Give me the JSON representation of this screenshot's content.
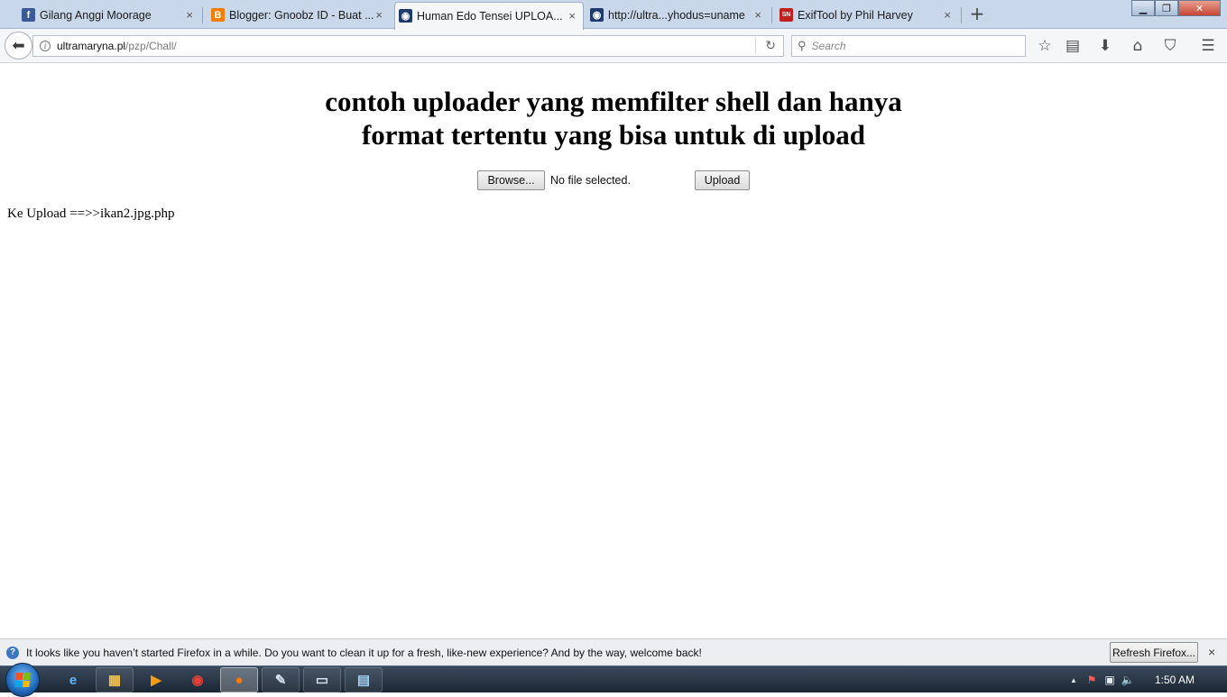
{
  "window": {
    "controls": {
      "minimize": "▁",
      "maximize": "❐",
      "close": "✕"
    }
  },
  "tabs": [
    {
      "label": "Gilang Anggi Moorage",
      "favicon": "facebook-icon",
      "favicon_text": "f",
      "favicon_color": "#3b5998",
      "active": false
    },
    {
      "label": "Blogger: Gnoobz ID - Buat ...",
      "favicon": "blogger-icon",
      "favicon_text": "B",
      "favicon_color": "#f57d00",
      "active": false
    },
    {
      "label": "Human Edo Tensei UPLOA...",
      "favicon": "site-globe-icon",
      "favicon_text": "◉",
      "favicon_color": "#1d3b6e",
      "active": true
    },
    {
      "label": "http://ultra...yhodus=uname",
      "favicon": "site-globe-icon",
      "favicon_text": "◉",
      "favicon_color": "#1d3b6e",
      "active": false
    },
    {
      "label": "ExifTool by Phil Harvey",
      "favicon": "exiftool-icon",
      "favicon_text": "SN",
      "favicon_color": "#c02020",
      "active": false
    }
  ],
  "tab_close_glyph": "×",
  "new_tab_glyph": "+",
  "navbar": {
    "back_glyph": "⬅",
    "info_glyph": "i",
    "url_domain": "ultramaryna.pl",
    "url_path": "/pzp/Chall/",
    "reload_glyph": "↻",
    "search_placeholder": "Search",
    "search_glyph": "⚲",
    "toolbar_icons": [
      {
        "name": "bookmark-star-icon",
        "glyph": "☆"
      },
      {
        "name": "reading-list-icon",
        "glyph": "▤"
      },
      {
        "name": "downloads-icon",
        "glyph": "⬇"
      },
      {
        "name": "home-icon",
        "glyph": "⌂"
      },
      {
        "name": "pocket-icon",
        "glyph": "⛉"
      },
      {
        "name": "menu-icon",
        "glyph": "☰"
      }
    ]
  },
  "page": {
    "title_line1": "contoh uploader yang memfilter shell dan hanya",
    "title_line2": "format tertentu yang bisa untuk di upload",
    "browse_label": "Browse...",
    "file_status": "No file selected.",
    "upload_label": "Upload",
    "result_text": "Ke Upload ==>>ikan2.jpg.php"
  },
  "notification": {
    "icon_glyph": "?",
    "message": "It looks like you haven’t started Firefox in a while. Do you want to clean it up for a fresh, like-new experience? And by the way, welcome back!",
    "refresh_label": "Refresh Firefox...",
    "close_glyph": "×"
  },
  "taskbar": {
    "apps": [
      {
        "name": "internet-explorer-icon",
        "glyph": "e",
        "color": "#5bb7ff",
        "state": "pinned"
      },
      {
        "name": "file-explorer-icon",
        "glyph": "▦",
        "color": "#f2c14e",
        "state": "pinned"
      },
      {
        "name": "media-player-icon",
        "glyph": "▶",
        "color": "#f39c12",
        "state": "pinned"
      },
      {
        "name": "chrome-icon",
        "glyph": "◉",
        "color": "#e94235",
        "state": "none"
      },
      {
        "name": "firefox-icon",
        "glyph": "●",
        "color": "#ff7a00",
        "state": "active"
      },
      {
        "name": "paint-icon",
        "glyph": "✎",
        "color": "#d7e3f0",
        "state": "pinned"
      },
      {
        "name": "console-window-icon",
        "glyph": "▭",
        "color": "#d7e3f0",
        "state": "pinned"
      },
      {
        "name": "notepad-icon",
        "glyph": "▤",
        "color": "#9fd2f5",
        "state": "pinned"
      }
    ],
    "tray_icons": [
      {
        "name": "show-hidden-icons-icon",
        "glyph": "▲"
      },
      {
        "name": "action-center-flag-icon",
        "glyph": "⚑"
      },
      {
        "name": "network-icon",
        "glyph": "▣"
      },
      {
        "name": "volume-icon",
        "glyph": "🔈"
      }
    ],
    "clock": "1:50 AM"
  }
}
